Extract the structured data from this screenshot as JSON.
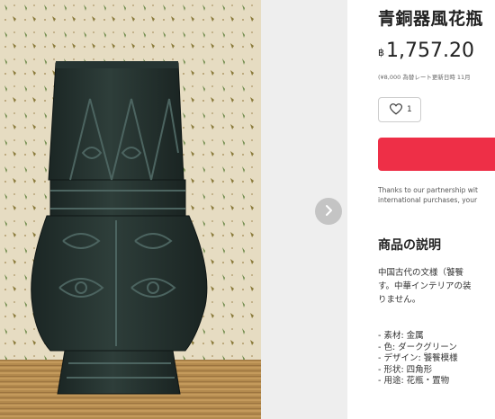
{
  "product": {
    "title": "青銅器風花瓶",
    "currency_symbol": "฿",
    "price": "1,757.20",
    "jpy_note": "(¥8,000 為替レート更新日時 11月",
    "likes": {
      "icon": "heart-icon",
      "count": "1"
    },
    "buy_button": {
      "color": "#ee2f47"
    },
    "partner_note": {
      "line1": "Thanks to our partnership wit",
      "line2": "international purchases, your"
    }
  },
  "description": {
    "heading": "商品の説明",
    "body": [
      "中国古代の文様（饕餮",
      "す。中華インテリアの装",
      "りません。"
    ],
    "specs": [
      "- 素材: 金属",
      "- 色: ダークグリーン",
      "- デザイン: 饕餮模様",
      "- 形状: 四角形",
      "- 用途: 花瓶・置物"
    ]
  },
  "gallery": {
    "next_icon": "chevron-right-icon",
    "photo": "bronze-vase-photo"
  }
}
